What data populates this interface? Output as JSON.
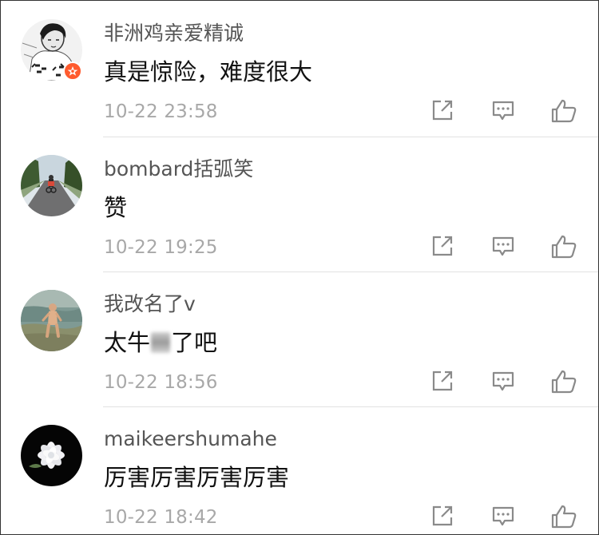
{
  "comments": [
    {
      "username": "非洲鸡亲爱精诚",
      "text": "真是惊险，难度很大",
      "time": "10-22 23:58",
      "avatar_icon": "sketch-portrait-avatar",
      "has_vip_badge": true
    },
    {
      "username": "bombard括弧笑",
      "text": "赞",
      "time": "10-22 19:25",
      "avatar_icon": "road-cyclist-avatar",
      "has_vip_badge": false
    },
    {
      "username": "我改名了v",
      "text_before_censor": "太牛",
      "text_after_censor": "了吧",
      "time": "10-22 18:56",
      "avatar_icon": "child-at-beach-avatar",
      "has_vip_badge": false
    },
    {
      "username": "maikeershumahe",
      "text": "厉害厉害厉害厉害",
      "time": "10-22 18:42",
      "avatar_icon": "white-flower-avatar",
      "has_vip_badge": false
    }
  ],
  "actions": {
    "share_icon": "share-icon",
    "reply_icon": "reply-icon",
    "like_icon": "like-icon"
  },
  "colors": {
    "username": "#555555",
    "text": "#111111",
    "time": "#a8a8a8",
    "icon": "#8a8a8a",
    "divider": "#e2e2e2",
    "vip_badge": "#ff5b2e"
  }
}
